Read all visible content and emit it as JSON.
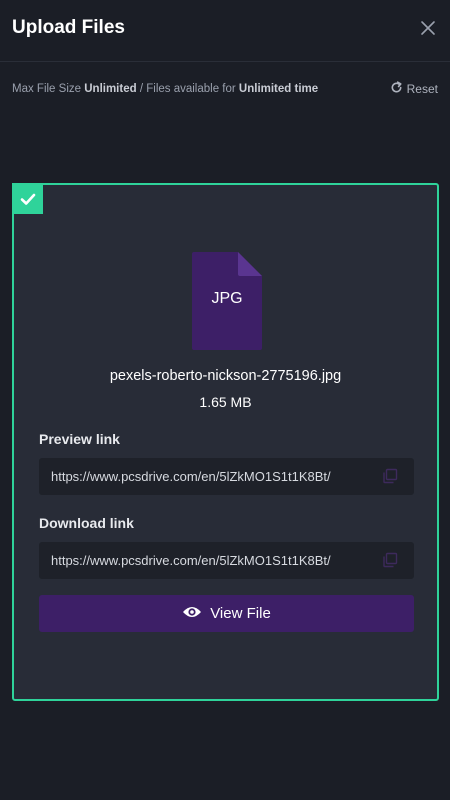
{
  "header": {
    "title": "Upload Files",
    "close_icon": "close-icon"
  },
  "info": {
    "max_file_size_label": "Max File Size",
    "max_file_size_value": "Unlimited",
    "separator": "/",
    "availability_label": "Files available for",
    "availability_value": "Unlimited time",
    "reset_label": "Reset",
    "reset_icon": "reset-icon"
  },
  "upload_card": {
    "status_icon": "checkmark-icon",
    "file_type": "JPG",
    "file_name": "pexels-roberto-nickson-2775196.jpg",
    "file_size": "1.65 MB",
    "preview": {
      "label": "Preview link",
      "url": "https://www.pcsdrive.com/en/5lZkMO1S1t1K8Bt/",
      "copy_icon": "copy-icon"
    },
    "download": {
      "label": "Download link",
      "url": "https://www.pcsdrive.com/en/5lZkMO1S1t1K8Bt/",
      "copy_icon": "copy-icon"
    },
    "view_button": {
      "label": "View File",
      "icon": "eye-icon"
    }
  },
  "colors": {
    "background": "#1b1e26",
    "card": "#282c37",
    "success": "#2fd39a",
    "accent": "#3d1f67",
    "file_icon": "#3d1f67"
  }
}
